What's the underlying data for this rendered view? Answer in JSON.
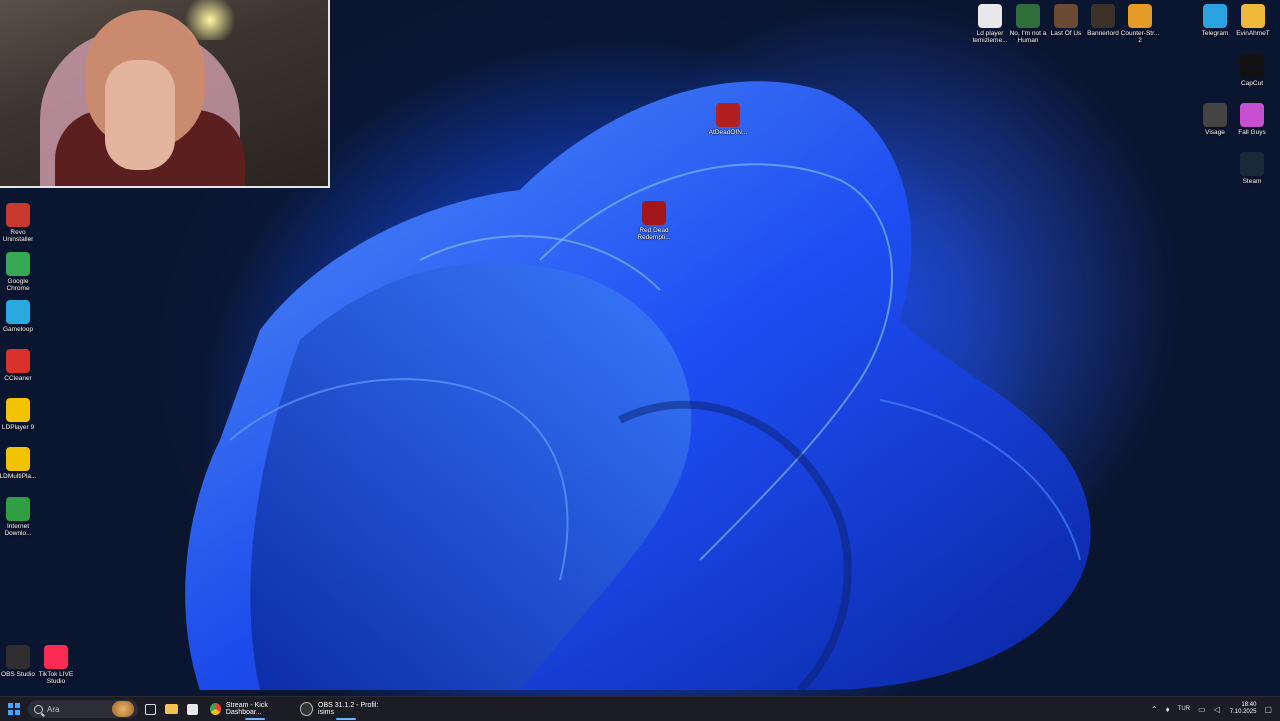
{
  "desktop_left_icons": [
    {
      "label": "Revo Uninstaller",
      "icon": "revo-uninstaller-icon",
      "color": "#c7382f"
    },
    {
      "label": "Google Chrome",
      "icon": "chrome-icon",
      "color": "#34a853"
    },
    {
      "label": "Gameloop",
      "icon": "gameloop-icon",
      "color": "#2aa9e0"
    },
    {
      "label": "CCleaner",
      "icon": "ccleaner-icon",
      "color": "#d8322b"
    },
    {
      "label": "LDPlayer 9",
      "icon": "ldplayer-icon",
      "color": "#f2c100"
    },
    {
      "label": "LDMultiPla...",
      "icon": "ldmultiplayer-icon",
      "color": "#f2c100"
    },
    {
      "label": "Internet Downlo...",
      "icon": "internet-download-manager-icon",
      "color": "#2f9e44"
    }
  ],
  "desktop_bottom_icons": [
    {
      "label": "OBS Studio",
      "icon": "obs-icon",
      "color": "#302e31"
    },
    {
      "label": "TikTok LIVE Studio",
      "icon": "tiktok-live-icon",
      "color": "#fe2c55"
    }
  ],
  "desktop_top_icons": [
    {
      "label": "Ld player temizleme...",
      "icon": "ldplayer-clean-icon",
      "color": "#e8e8e8"
    },
    {
      "label": "No, I'm not a Human",
      "icon": "not-human-game-icon",
      "color": "#2f6d3a"
    },
    {
      "label": "Last Of Us",
      "icon": "last-of-us-icon",
      "color": "#6b4a33"
    },
    {
      "label": "Bannerlord",
      "icon": "bannerlord-icon",
      "color": "#3a3226"
    },
    {
      "label": "Counter-Str... 2",
      "icon": "counter-strike-icon",
      "color": "#e59a26"
    },
    {
      "label": "Telegram",
      "icon": "telegram-icon",
      "color": "#2aa3df"
    },
    {
      "label": "EvinAhmeT",
      "icon": "folder-icon",
      "color": "#f0b93a"
    }
  ],
  "desktop_right_icons": [
    {
      "label": "CapCut",
      "icon": "capcut-icon",
      "color": "#111111"
    },
    {
      "label": "Visage",
      "icon": "visage-icon",
      "color": "#444444"
    },
    {
      "label": "Fall Guys",
      "icon": "fall-guys-icon",
      "color": "#c84fd0"
    },
    {
      "label": "Steam",
      "icon": "steam-icon",
      "color": "#1b2838"
    }
  ],
  "desktop_center_icons": [
    {
      "label": "AtDeadOfN...",
      "icon": "at-dead-of-night-icon",
      "color": "#b31e1e"
    },
    {
      "label": "Red Dead Redempti...",
      "icon": "red-dead-redemption-icon",
      "color": "#a0161a"
    }
  ],
  "taskbar": {
    "search_placeholder": "Ara",
    "tasks": [
      {
        "label": "Stream - Kick Dashboar...",
        "icon": "chrome-icon"
      },
      {
        "label": "OBS 31.1.2 - Profil: isims",
        "icon": "obs-icon"
      }
    ],
    "language": "TUR",
    "time": "18:40",
    "date": "7.10.2025"
  }
}
